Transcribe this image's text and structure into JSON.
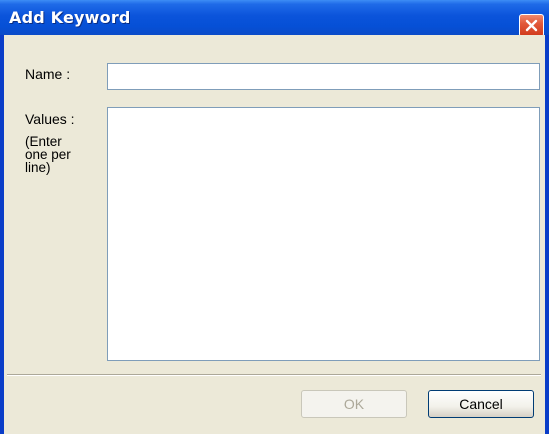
{
  "window": {
    "title": "Add Keyword"
  },
  "form": {
    "name_label": "Name :",
    "name_value": "",
    "values_label": "Values :",
    "values_hint": "(Enter one per line)",
    "values_value": ""
  },
  "buttons": {
    "ok_label": "OK",
    "ok_enabled": false,
    "cancel_label": "Cancel"
  },
  "icons": {
    "close": "close-icon"
  },
  "colors": {
    "titlebar": "#0B54DB",
    "close_button": "#D0391A",
    "dialog_background": "#ECE9D8",
    "field_border": "#7F9DB9",
    "disabled_text": "#ACA899"
  }
}
